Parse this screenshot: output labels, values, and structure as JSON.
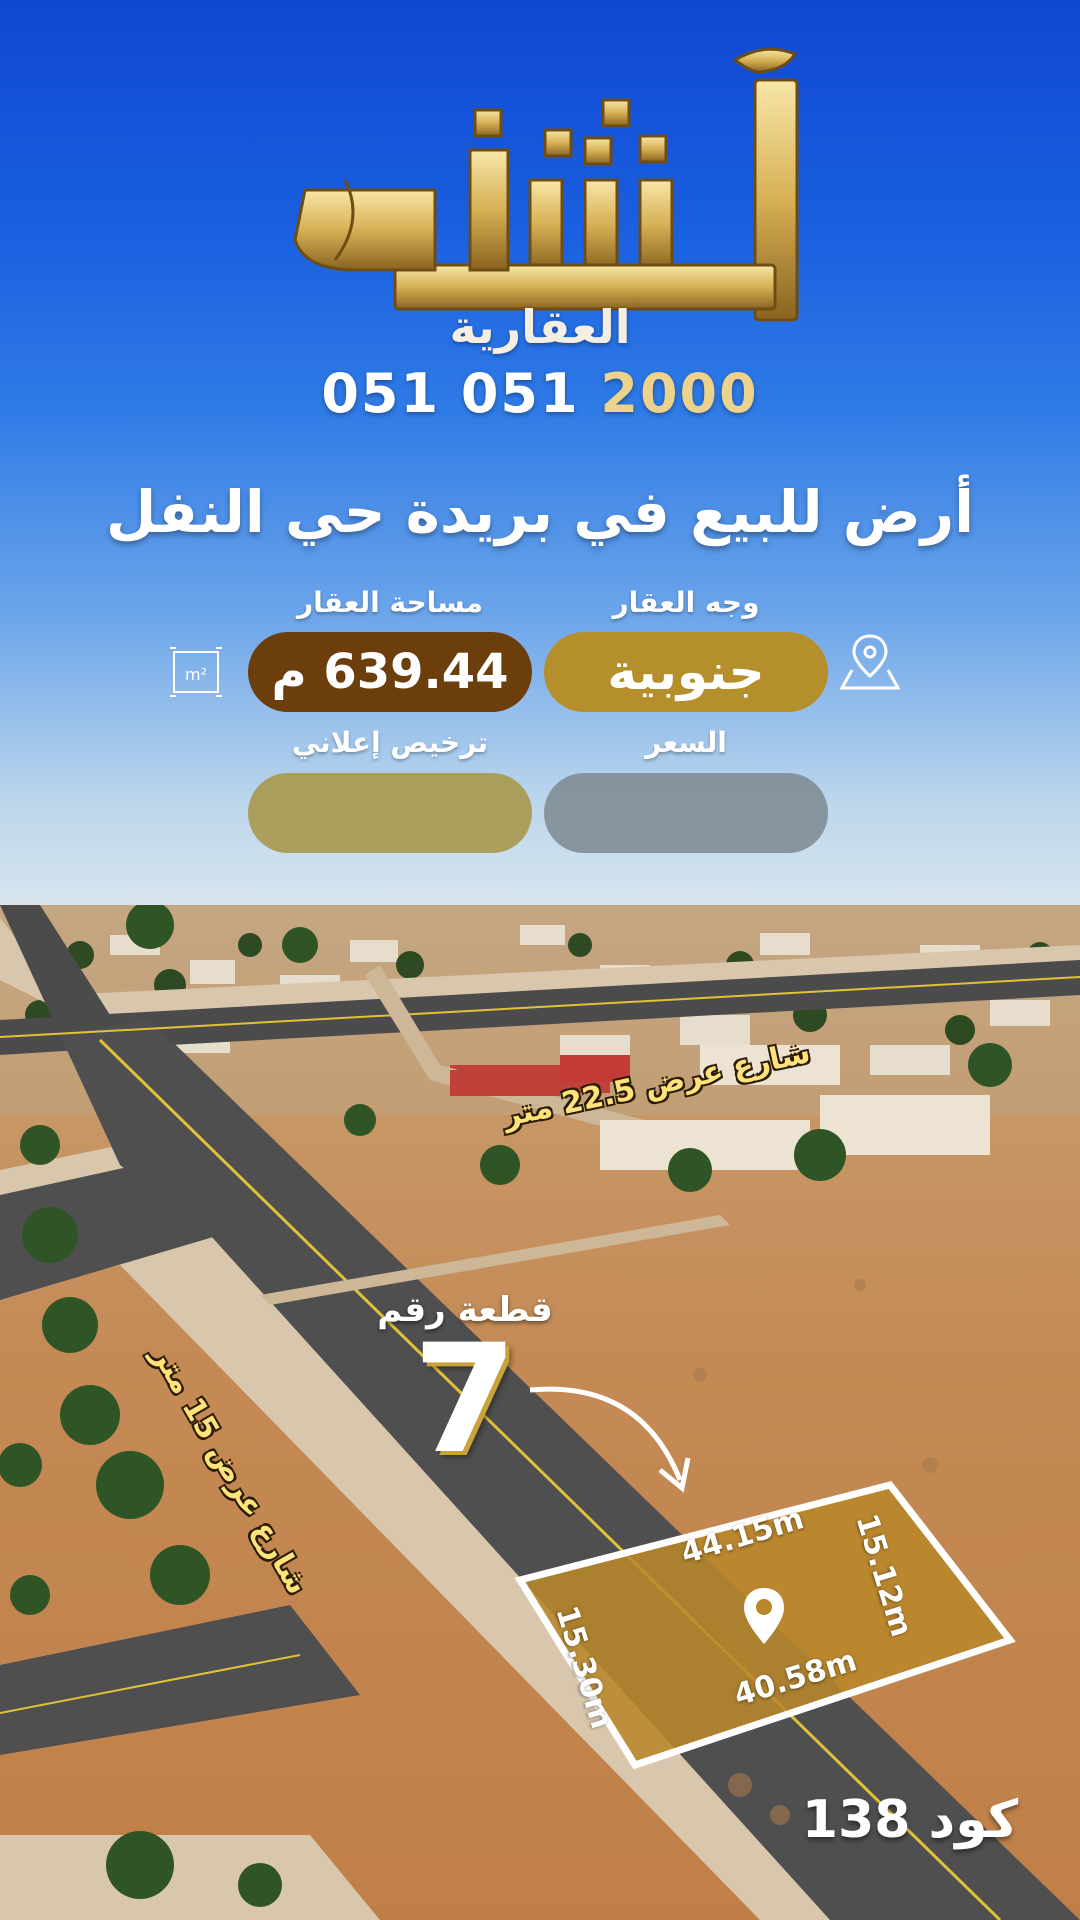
{
  "logo": {
    "brand": "استثمر",
    "subtitle": "العقارية",
    "phone_prefix": "051 051",
    "phone_suffix": "2000"
  },
  "headline": "أرض للبيع في بريدة حي النفل",
  "details": {
    "facing_label": "وجه العقار",
    "facing_value": "جنوبية",
    "area_label": "مساحة العقار",
    "area_value": "639.44 م",
    "price_label": "السعر",
    "price_value": "",
    "license_label": "ترخيص إعلاني",
    "license_value": "",
    "m2_icon_text": "m²"
  },
  "map": {
    "street_wide": "شارع عرض 22.5 متر",
    "street_narrow": "شارع عرض 15 متر",
    "plot_label": "قطعة رقم",
    "plot_number": "7",
    "dims": {
      "top": "44.15m",
      "bottom": "40.58m",
      "left": "15.30m",
      "right": "15.12m"
    },
    "code": "كود 138"
  },
  "colors": {
    "sky_top": "#0f47d3",
    "gold": "#b48f2c",
    "brown": "#6b3e0c",
    "plot_fill": "#b8872a"
  },
  "icons": [
    "location-pin-icon",
    "area-m2-icon",
    "curved-arrow-icon",
    "map-pin-icon"
  ]
}
